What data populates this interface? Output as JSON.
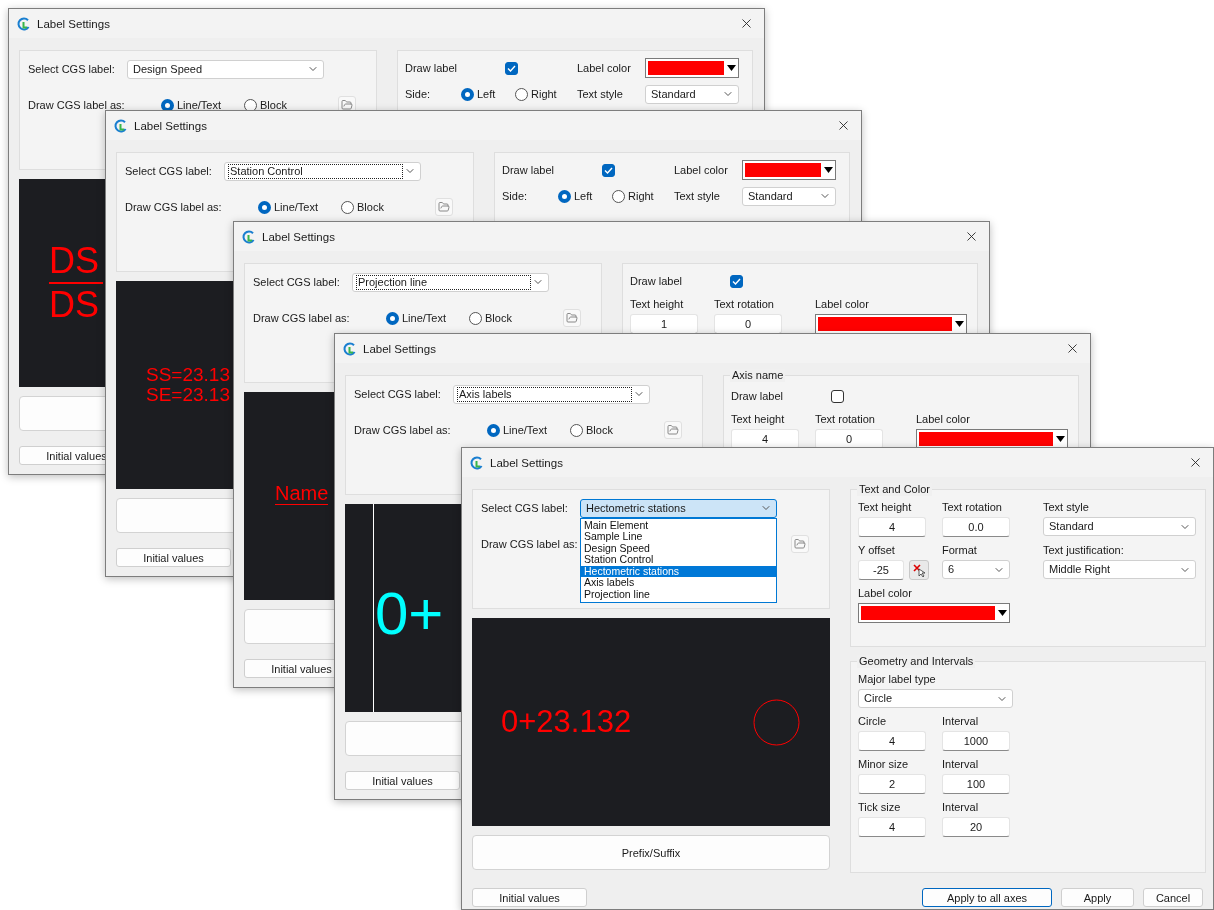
{
  "windows": [
    {
      "title": "Label Settings",
      "select": {
        "label": "Select CGS label:",
        "value": "Design Speed",
        "focused": false,
        "open": false
      },
      "draw_as": {
        "label": "Draw CGS label as:",
        "options": [
          {
            "label": "Line/Text",
            "selected": true
          },
          {
            "label": "Block",
            "selected": false
          }
        ]
      },
      "settings": [
        {
          "rows": [
            {
              "kind": "inline",
              "cells": [
                {
                  "kind": "check",
                  "label": "Draw label",
                  "checked": true
                },
                {
                  "kind": "color",
                  "label": "Label color",
                  "color": "#ff0000"
                }
              ]
            },
            {
              "kind": "inline",
              "cells": [
                {
                  "kind": "radios",
                  "label": "Side:",
                  "options": [
                    {
                      "label": "Left",
                      "selected": true
                    },
                    {
                      "label": "Right",
                      "selected": false
                    }
                  ]
                },
                {
                  "kind": "combo",
                  "label": "Text style",
                  "value": "Standard"
                }
              ]
            }
          ]
        }
      ],
      "preview": {
        "kind": "stacked",
        "texts": [
          {
            "text": "DS",
            "color": "#ff0000"
          },
          {
            "text": "DS",
            "color": "#ff0000"
          }
        ]
      },
      "initial_button": "Initial values"
    },
    {
      "title": "Label Settings",
      "select": {
        "label": "Select CGS label:",
        "value": "Station Control",
        "focused": true,
        "open": false
      },
      "draw_as": {
        "label": "Draw CGS label as:",
        "options": [
          {
            "label": "Line/Text",
            "selected": true
          },
          {
            "label": "Block",
            "selected": false
          }
        ]
      },
      "settings": [
        {
          "rows": [
            {
              "kind": "inline",
              "cells": [
                {
                  "kind": "check",
                  "label": "Draw label",
                  "checked": true
                },
                {
                  "kind": "color",
                  "label": "Label color",
                  "color": "#ff0000"
                }
              ]
            },
            {
              "kind": "inline",
              "cells": [
                {
                  "kind": "radios",
                  "label": "Side:",
                  "options": [
                    {
                      "label": "Left",
                      "selected": true
                    },
                    {
                      "label": "Right",
                      "selected": false
                    }
                  ]
                },
                {
                  "kind": "combo",
                  "label": "Text style",
                  "value": "Standard"
                }
              ]
            }
          ]
        }
      ],
      "preview": {
        "kind": "pair",
        "texts": [
          {
            "text": "SS=23.13",
            "color": "#ff0000"
          },
          {
            "text": "SE=23.13",
            "color": "#ff0000"
          }
        ]
      },
      "initial_button": "Initial values"
    },
    {
      "title": "Label Settings",
      "select": {
        "label": "Select CGS label:",
        "value": "Projection line",
        "focused": true,
        "open": false
      },
      "draw_as": {
        "label": "Draw CGS label as:",
        "options": [
          {
            "label": "Line/Text",
            "selected": true
          },
          {
            "label": "Block",
            "selected": false
          }
        ]
      },
      "settings": [
        {
          "rows": [
            {
              "kind": "inline",
              "cells": [
                {
                  "kind": "check",
                  "label": "Draw label",
                  "checked": true
                }
              ]
            },
            {
              "kind": "stacked",
              "cells": [
                {
                  "kind": "field",
                  "label": "Text height",
                  "value": "1"
                },
                {
                  "kind": "field",
                  "label": "Text rotation",
                  "value": "0"
                },
                {
                  "kind": "color",
                  "label": "Label color",
                  "color": "#ff0000"
                }
              ]
            }
          ]
        }
      ],
      "preview": {
        "kind": "underlined",
        "texts": [
          {
            "text": "Name",
            "color": "#ff0000"
          }
        ]
      },
      "initial_button": "Initial values"
    },
    {
      "title": "Label Settings",
      "select": {
        "label": "Select CGS label:",
        "value": "Axis labels",
        "focused": true,
        "open": false
      },
      "draw_as": {
        "label": "Draw CGS label as:",
        "options": [
          {
            "label": "Line/Text",
            "selected": true
          },
          {
            "label": "Block",
            "selected": false
          }
        ]
      },
      "settings": [
        {
          "legend": "Axis name",
          "rows": [
            {
              "kind": "inline",
              "cells": [
                {
                  "kind": "check",
                  "label": "Draw label",
                  "checked": false
                }
              ]
            },
            {
              "kind": "stacked",
              "cells": [
                {
                  "kind": "field",
                  "label": "Text height",
                  "value": "4"
                },
                {
                  "kind": "field",
                  "label": "Text rotation",
                  "value": "0"
                },
                {
                  "kind": "color",
                  "label": "Label color",
                  "color": "#ff0000"
                }
              ]
            }
          ]
        }
      ],
      "preview": {
        "kind": "axis",
        "texts": [
          {
            "text": "0+",
            "color": "#00ffff"
          }
        ]
      },
      "initial_button": "Initial values"
    },
    {
      "title": "Label Settings",
      "select": {
        "label": "Select CGS label:",
        "value": "Hectometric stations",
        "focused": false,
        "open": true,
        "options": [
          {
            "label": "Main Element",
            "selected": false
          },
          {
            "label": "Sample Line",
            "selected": false
          },
          {
            "label": "Design Speed",
            "selected": false
          },
          {
            "label": "Station Control",
            "selected": false
          },
          {
            "label": "Hectometric stations",
            "selected": true
          },
          {
            "label": "Axis labels",
            "selected": false
          },
          {
            "label": "Projection line",
            "selected": false
          }
        ]
      },
      "draw_as": {
        "label": "Draw CGS label as:"
      },
      "settings": [
        {
          "legend": "Text and Color",
          "rows": [
            {
              "kind": "stacked",
              "cells": [
                {
                  "kind": "field",
                  "label": "Text height",
                  "value": "4"
                },
                {
                  "kind": "field",
                  "label": "Text rotation",
                  "value": "0.0"
                },
                {
                  "kind": "combo",
                  "label": "Text style",
                  "value": "Standard"
                }
              ]
            },
            {
              "kind": "stacked",
              "cells": [
                {
                  "kind": "offset",
                  "label": "Y offset",
                  "value": "-25"
                },
                {
                  "kind": "combo",
                  "label": "Format",
                  "value": "6"
                },
                {
                  "kind": "combo",
                  "label": "Text justification:",
                  "value": "Middle Right"
                }
              ]
            },
            {
              "kind": "stacked",
              "cells": [
                {
                  "kind": "color",
                  "label": "Label color",
                  "color": "#ff0000"
                }
              ]
            }
          ]
        },
        {
          "legend": "Geometry and Intervals",
          "rows": [
            {
              "kind": "stacked",
              "cells": [
                {
                  "kind": "combo",
                  "label": "Major label type",
                  "value": "Circle"
                }
              ]
            },
            {
              "kind": "stacked",
              "cells": [
                {
                  "kind": "field",
                  "label": "Circle",
                  "value": "4"
                },
                {
                  "kind": "field",
                  "label": "Interval",
                  "value": "1000"
                }
              ]
            },
            {
              "kind": "stacked",
              "cells": [
                {
                  "kind": "field",
                  "label": "Minor size",
                  "value": "2"
                },
                {
                  "kind": "field",
                  "label": "Interval",
                  "value": "100"
                }
              ]
            },
            {
              "kind": "stacked",
              "cells": [
                {
                  "kind": "field",
                  "label": "Tick size",
                  "value": "4"
                },
                {
                  "kind": "field",
                  "label": "Interval",
                  "value": "20"
                }
              ]
            }
          ]
        }
      ],
      "preview": {
        "kind": "station",
        "texts": [
          {
            "text": "0+23.132",
            "color": "#ff0000"
          }
        ]
      },
      "prefix_suffix": "Prefix/Suffix",
      "initial_button": "Initial values",
      "buttons": [
        {
          "label": "Apply to all axes",
          "default": true
        },
        {
          "label": "Apply",
          "default": false
        },
        {
          "label": "Cancel",
          "default": false
        }
      ]
    }
  ]
}
